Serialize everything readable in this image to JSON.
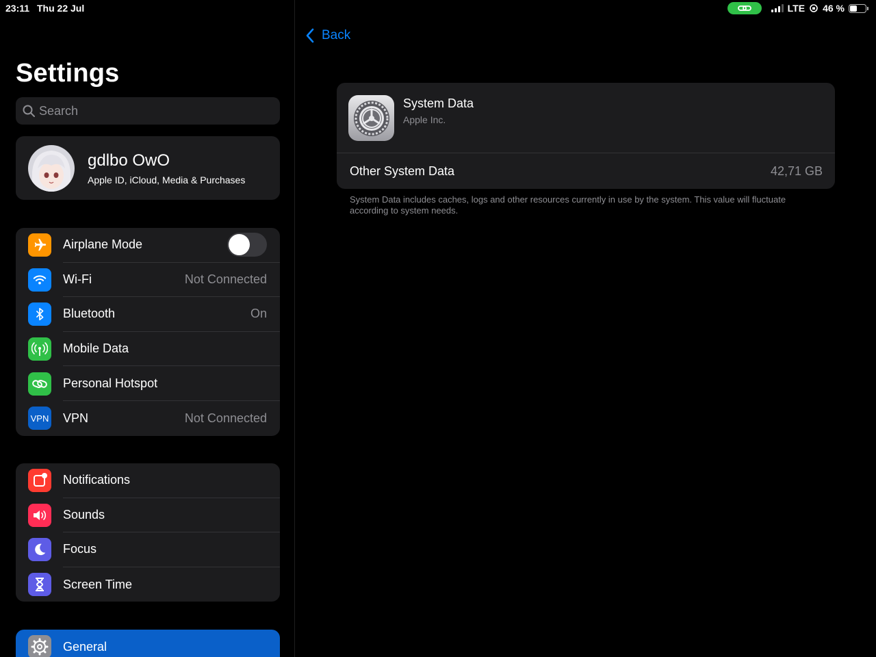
{
  "status_bar": {
    "time": "23:11",
    "date": "Thu 22 Jul",
    "network": "LTE",
    "battery": "46 %",
    "battery_level": 0.46,
    "hotspot_color": "#30c048"
  },
  "sidebar": {
    "title": "Settings",
    "search_placeholder": "Search",
    "profile": {
      "name": "gdlbo OwO",
      "subtitle": "Apple ID, iCloud, Media & Purchases"
    },
    "connectivity": [
      {
        "label": "Airplane Mode",
        "icon": "airplane-icon",
        "color": "#ff9500",
        "toggle": false
      },
      {
        "label": "Wi-Fi",
        "icon": "wifi-icon",
        "color": "#0a84ff",
        "value": "Not Connected"
      },
      {
        "label": "Bluetooth",
        "icon": "bluetooth-icon",
        "color": "#0a84ff",
        "value": "On"
      },
      {
        "label": "Mobile Data",
        "icon": "antenna-icon",
        "color": "#30c048",
        "value": ""
      },
      {
        "label": "Personal Hotspot",
        "icon": "hotspot-link-icon",
        "color": "#30c048",
        "value": ""
      },
      {
        "label": "VPN",
        "icon": "vpn-icon",
        "icon_text": "VPN",
        "color": "#0a60c9",
        "value": "Not Connected"
      }
    ],
    "alerts": [
      {
        "label": "Notifications",
        "icon": "notifications-icon",
        "color": "#ff3b30"
      },
      {
        "label": "Sounds",
        "icon": "speaker-icon",
        "color": "#ff2d55"
      },
      {
        "label": "Focus",
        "icon": "moon-icon",
        "color": "#5e5ce6"
      },
      {
        "label": "Screen Time",
        "icon": "hourglass-icon",
        "color": "#5e5ce6"
      }
    ],
    "general": {
      "label": "General",
      "icon": "gear-icon",
      "color": "#8e8e93",
      "selected_color": "#0a60c9"
    }
  },
  "detail": {
    "back_label": "Back",
    "app_name": "System Data",
    "app_vendor": "Apple Inc.",
    "row_label": "Other System Data",
    "row_value": "42,71 GB",
    "footnote": "System Data includes caches, logs and other resources currently in use by the system. This value will fluctuate according to system needs."
  }
}
